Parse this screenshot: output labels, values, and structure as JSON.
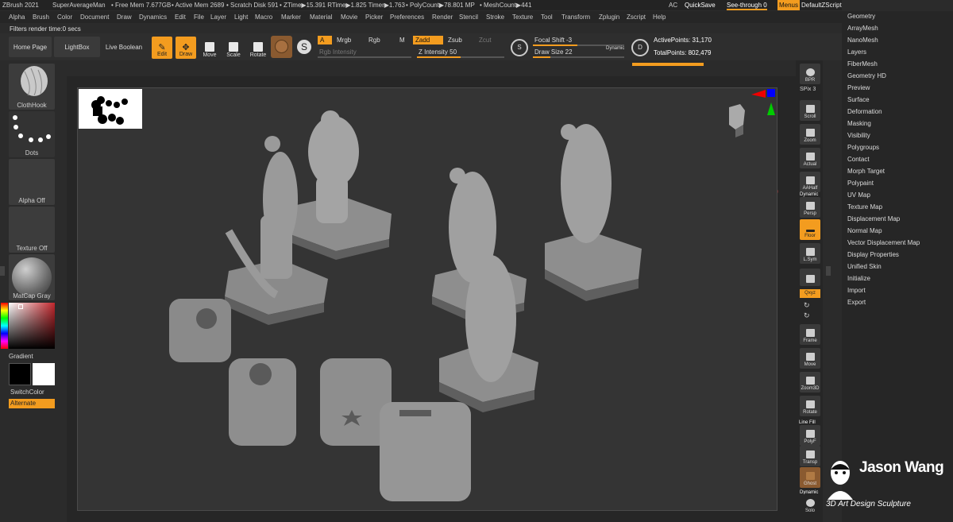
{
  "titlebar": {
    "app": "ZBrush 2021",
    "user": "SuperAverageMan",
    "free_mem": "• Free Mem 7.677GB",
    "active_mem": "• Active Mem 2689",
    "scratch": "• Scratch Disk 591",
    "ztime": "• ZTime▶15.391 RTime▶1.825 Timer▶1.763",
    "poly": "• PolyCount▶78.801 MP",
    "mesh": "• MeshCount▶441",
    "ac": "AC",
    "quicksave": "QuickSave",
    "seethrough": "See-through  0",
    "menus": "Menus",
    "script": "DefaultZScript"
  },
  "menu": [
    "Alpha",
    "Brush",
    "Color",
    "Document",
    "Draw",
    "Dynamics",
    "Edit",
    "File",
    "Layer",
    "Light",
    "Macro",
    "Marker",
    "Material",
    "Movie",
    "Picker",
    "Preferences",
    "Render",
    "Stencil",
    "Stroke",
    "Texture",
    "Tool",
    "Transform",
    "Zplugin",
    "Zscript",
    "Help"
  ],
  "status": "Filters render time:0 secs",
  "toolbar": {
    "home": "Home Page",
    "lightbox": "LightBox",
    "liveboolean": "Live Boolean",
    "edit": "Edit",
    "draw": "Draw",
    "move": "Move",
    "scale": "Scale",
    "rotate": "Rotate",
    "a": "A",
    "mrgb": "Mrgb",
    "rgb": "Rgb",
    "m": "M",
    "zadd": "Zadd",
    "zsub": "Zsub",
    "zcut": "Zcut",
    "rgb_intensity": "Rgb Intensity",
    "z_intensity": "Z Intensity 50",
    "focal_shift": "Focal Shift -3",
    "draw_size": "Draw Size 22",
    "dynamic": "Dynamic",
    "active_points": "ActivePoints: 31,170",
    "total_points": "TotalPoints: 802,479",
    "z_intensity_value": 50
  },
  "left": {
    "brush": "ClothHook",
    "stroke": "Dots",
    "alpha": "Alpha Off",
    "texture": "Texture Off",
    "material": "MatCap Gray",
    "gradient": "Gradient",
    "switchcolor": "SwitchColor",
    "alternate": "Alternate"
  },
  "right": {
    "bpr": "BPR",
    "spix": "SPix 3",
    "scroll": "Scroll",
    "zoom": "Zoom",
    "actual": "Actual",
    "aahalf": "AAHalf",
    "dynamic": "Dynamic",
    "persp": "Persp",
    "floor": "Floor",
    "lsym": "L.Sym",
    "xyz": "Qxyz",
    "frame": "Frame",
    "move": "Move",
    "zoom3d": "Zoom3D",
    "rotate": "Rotate",
    "linefill": "Line Fill",
    "polyf": "PolyF",
    "transp": "Transp",
    "ghost": "Ghost",
    "dyn2": "Dynamic",
    "solo": "Solo"
  },
  "tool_menu": [
    "Geometry",
    "ArrayMesh",
    "NanoMesh",
    "Layers",
    "FiberMesh",
    "Geometry HD",
    "Preview",
    "Surface",
    "Deformation",
    "Masking",
    "Visibility",
    "Polygroups",
    "Contact",
    "Morph Target",
    "Polypaint",
    "UV Map",
    "Texture Map",
    "Displacement Map",
    "Normal Map",
    "Vector Displacement Map",
    "Display Properties",
    "Unified Skin",
    "Initialize",
    "Import",
    "Export"
  ],
  "watermark": {
    "name": "Jason Wang",
    "tagline": "3D Art Design Sculpture"
  },
  "colors": {
    "accent": "#f39c1f",
    "bg": "#2b2b2b"
  }
}
